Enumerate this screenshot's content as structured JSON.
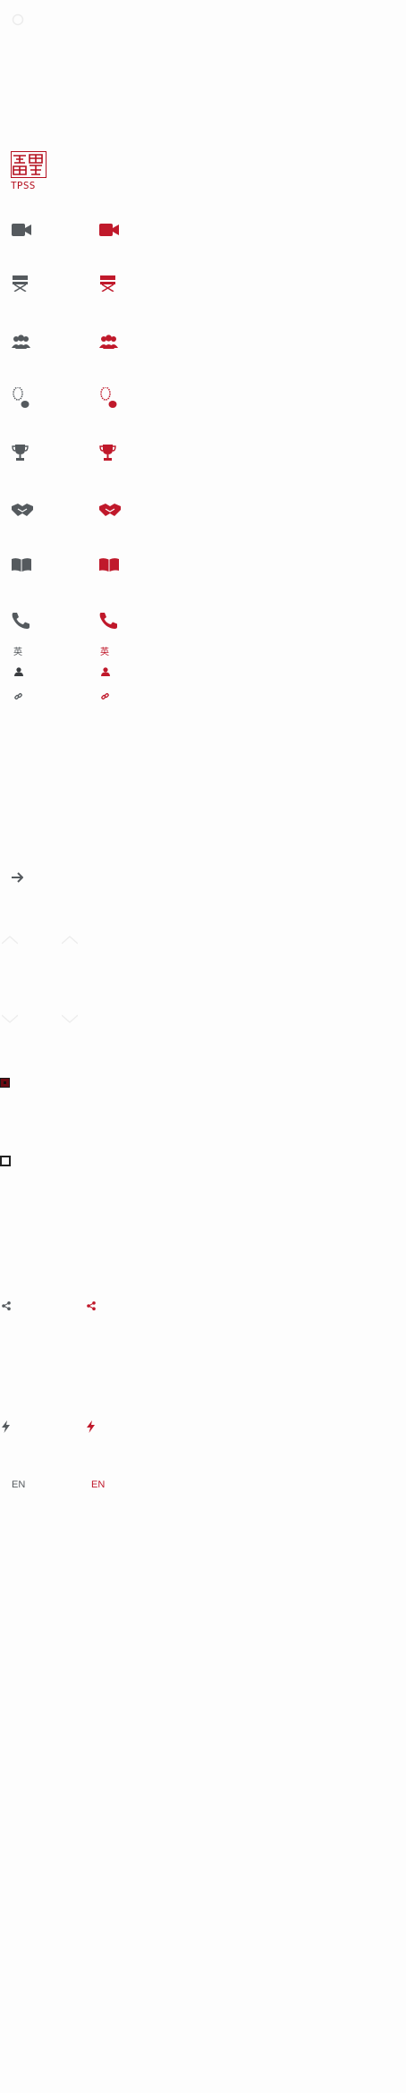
{
  "logo": {
    "text": "TPSS",
    "color": "#b5101f"
  },
  "colors": {
    "grey": "#555a5e",
    "red": "#c0192b",
    "faint": "#e6e6e6"
  },
  "icons": [
    "video-camera-icon",
    "director-chair-icon",
    "group-icon",
    "footprint-icon",
    "trophy-icon",
    "handshake-icon",
    "book-icon",
    "phone-icon",
    "character-icon",
    "user-icon",
    "link-icon",
    "arrow-right-icon",
    "chevron-up-icon",
    "chevron-down-icon",
    "checkbox-checked-icon",
    "checkbox-unchecked-icon",
    "share-icon",
    "lightning-icon"
  ],
  "char_label": "英",
  "language_label": "EN"
}
